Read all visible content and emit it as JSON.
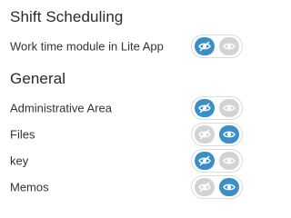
{
  "sections": [
    {
      "title": "Shift Scheduling",
      "rows": [
        {
          "label": "Work time module in Lite App",
          "active": "left"
        }
      ]
    },
    {
      "title": "General",
      "rows": [
        {
          "label": "Administrative Area",
          "active": "left"
        },
        {
          "label": "Files",
          "active": "right"
        },
        {
          "label": "key",
          "active": "left"
        },
        {
          "label": "Memos",
          "active": "right"
        }
      ]
    }
  ],
  "toggle": {
    "left_icon": "eye-slash-icon",
    "right_icon": "eye-icon",
    "active_color": "#3a8fc6",
    "inactive_color": "#d3d3d3"
  }
}
